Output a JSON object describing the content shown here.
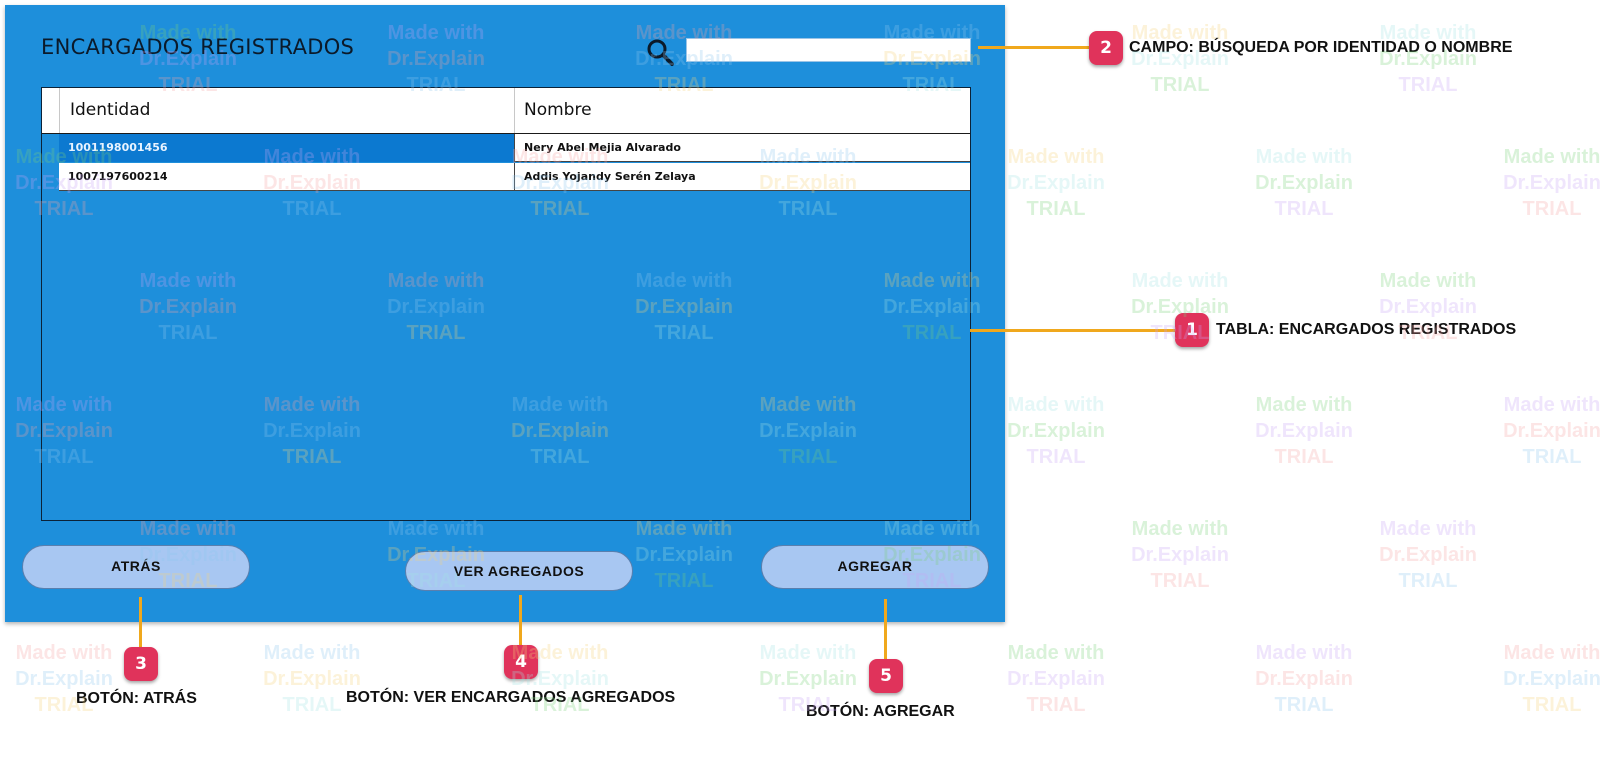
{
  "window": {
    "title": "ENCARGADOS REGISTRADOS",
    "search": {
      "value": "",
      "placeholder": ""
    }
  },
  "table": {
    "columns": [
      "Identidad",
      "Nombre"
    ],
    "rows": [
      {
        "identidad": "1001198001456",
        "nombre": "Nery Abel Mejia Alvarado",
        "selected": true
      },
      {
        "identidad": "1007197600214",
        "nombre": "Addis Yojandy Serén Zelaya",
        "selected": false
      }
    ]
  },
  "buttons": {
    "back": "ATRÁS",
    "view_added": "VER AGREGADOS",
    "add": "AGREGAR"
  },
  "callouts": [
    {
      "number": "1",
      "label": "TABLA: ENCARGADOS REGISTRADOS"
    },
    {
      "number": "2",
      "label": "CAMPO: BÚSQUEDA POR IDENTIDAD O NOMBRE"
    },
    {
      "number": "3",
      "label": "BOTÓN: ATRÁS"
    },
    {
      "number": "4",
      "label": "BOTÓN: VER ENCARGADOS AGREGADOS"
    },
    {
      "number": "5",
      "label": "BOTÓN: AGREGAR"
    }
  ],
  "watermark": [
    "Made with",
    "Dr.Explain",
    "TRIAL"
  ],
  "colors": {
    "panel": "#1e8fdb",
    "selected_row": "#0c79d0",
    "button": "#a8c7f2",
    "marker": "#e0335b",
    "leader_line": "#f0a81d"
  }
}
